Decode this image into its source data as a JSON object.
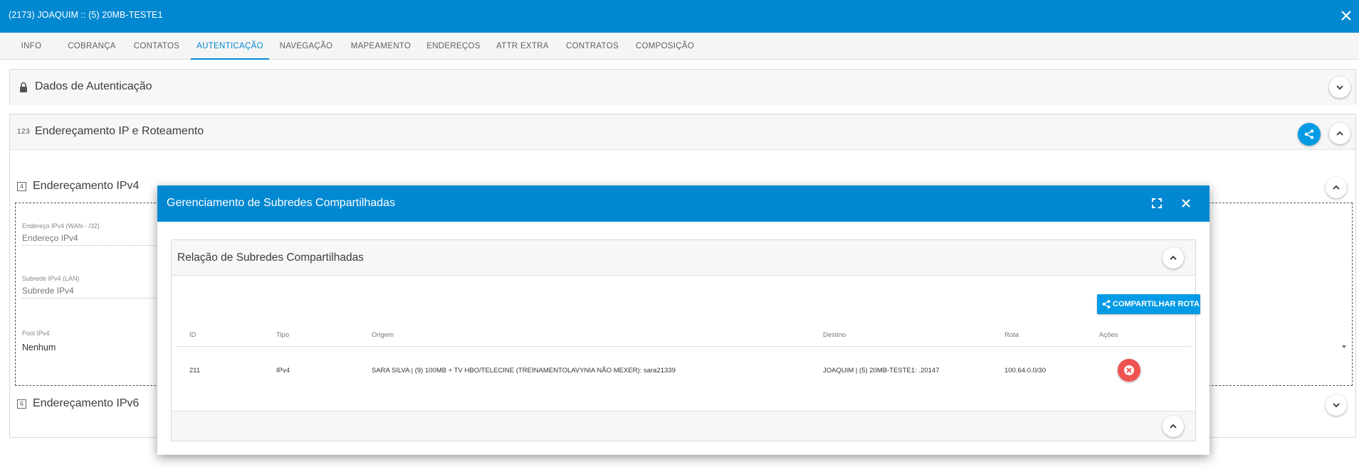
{
  "window": {
    "title": "(2173) JOAQUIM :: (5) 20MB-TESTE1"
  },
  "tabs": [
    {
      "label": "INFO"
    },
    {
      "label": "COBRANÇA"
    },
    {
      "label": "CONTATOS"
    },
    {
      "label": "AUTENTICAÇÃO",
      "active": true
    },
    {
      "label": "NAVEGAÇÃO"
    },
    {
      "label": "MAPEAMENTO"
    },
    {
      "label": "ENDEREÇOS"
    },
    {
      "label": "ATTR EXTRA"
    },
    {
      "label": "CONTRATOS"
    },
    {
      "label": "COMPOSIÇÃO"
    }
  ],
  "auth_panel": {
    "title": "Dados de Autenticação",
    "icon": "lock-icon"
  },
  "ip_panel": {
    "title": "Endereçamento IP e Roteamento",
    "icon_text": "123",
    "ipv4": {
      "title": "Endereçamento IPv4",
      "icon_text": "4",
      "wan_label": "Endereço IPv4 (WAN - /32)",
      "wan_placeholder": "Endereço IPv4",
      "lan_label": "Subrede IPv4 (LAN)",
      "lan_placeholder": "Subrede IPv4",
      "pool_label": "Pool IPv4",
      "pool_value": "Nenhum"
    },
    "ipv6": {
      "title": "Endereçamento IPv6",
      "icon_text": "6"
    }
  },
  "modal": {
    "title": "Gerenciamento de Subredes Compartilhadas",
    "section_title": "Relação de Subredes Compartilhadas",
    "share_route_label": "COMPARTILHAR ROTA",
    "columns": {
      "id": "ID",
      "tipo": "Tipo",
      "origem": "Origem",
      "destino": "Destino",
      "rota": "Rota",
      "acoes": "Ações"
    },
    "rows": [
      {
        "id": "211",
        "tipo": "IPv4",
        "origem": "SARA SILVA | (9) 100MB + TV HBO/TELECINE (TREINAMENTOLAVYNIA NÃO MEXER): sara21339",
        "destino": "JOAQUIM | (5) 20MB-TESTE1: .20147",
        "rota": "100.64.0.0/30"
      }
    ]
  },
  "colors": {
    "primary": "#0288d1",
    "accent": "#039be5",
    "danger": "#ef5350"
  }
}
